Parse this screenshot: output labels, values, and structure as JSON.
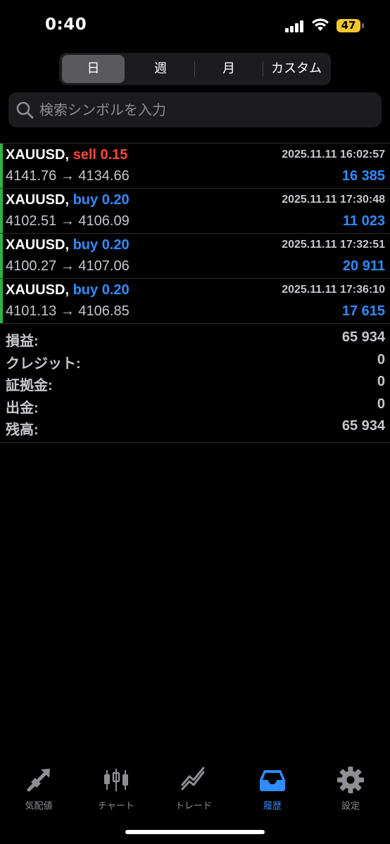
{
  "status": {
    "time": "0:40",
    "battery": "47"
  },
  "segments": [
    "日",
    "週",
    "月",
    "カスタム"
  ],
  "search": {
    "placeholder": "検索シンボルを入力"
  },
  "trades": [
    {
      "symbol": "XAUUSD,",
      "side": "sell",
      "volume": "0.15",
      "datetime": "2025.11.11 16:02:57",
      "open": "4141.76",
      "close": "4134.66",
      "profit": "16 385"
    },
    {
      "symbol": "XAUUSD,",
      "side": "buy",
      "volume": "0.20",
      "datetime": "2025.11.11 17:30:48",
      "open": "4102.51",
      "close": "4106.09",
      "profit": "11 023"
    },
    {
      "symbol": "XAUUSD,",
      "side": "buy",
      "volume": "0.20",
      "datetime": "2025.11.11 17:32:51",
      "open": "4100.27",
      "close": "4107.06",
      "profit": "20 911"
    },
    {
      "symbol": "XAUUSD,",
      "side": "buy",
      "volume": "0.20",
      "datetime": "2025.11.11 17:36:10",
      "open": "4101.13",
      "close": "4106.85",
      "profit": "17 615"
    }
  ],
  "arrow": "→",
  "summary": [
    {
      "label": "損益:",
      "value": "65 934"
    },
    {
      "label": "クレジット:",
      "value": "0"
    },
    {
      "label": "証拠金:",
      "value": "0"
    },
    {
      "label": "出金:",
      "value": "0"
    },
    {
      "label": "残高:",
      "value": "65 934"
    }
  ],
  "tabs": [
    {
      "label": "気配値",
      "icon": "quotes-arrow-icon"
    },
    {
      "label": "チャート",
      "icon": "candlestick-icon"
    },
    {
      "label": "トレード",
      "icon": "trade-chart-icon"
    },
    {
      "label": "履歴",
      "icon": "inbox-icon",
      "active": true
    },
    {
      "label": "設定",
      "icon": "gear-icon"
    }
  ],
  "colors": {
    "accent": "#2f8cff",
    "sell": "#ff453a",
    "buy": "#2f8cff",
    "position_bar": "#2fb344",
    "battery": "#f3c72b"
  }
}
